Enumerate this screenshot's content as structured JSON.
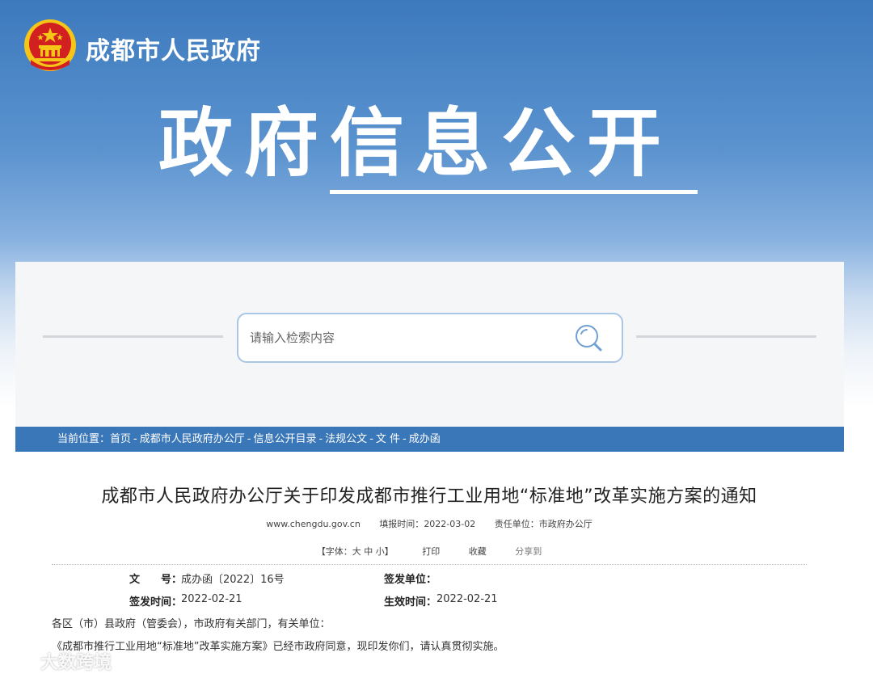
{
  "header": {
    "site_name": "成都市人民政府",
    "section_title": "政府信息公开"
  },
  "search": {
    "placeholder": "请输入检索内容"
  },
  "breadcrumb": {
    "prefix": "当前位置：",
    "items": [
      "首页",
      "成都市人民政府办公厅",
      "信息公开目录",
      "法规公文",
      "文 件",
      "成办函"
    ],
    "separator": "-"
  },
  "document": {
    "title": "成都市人民政府办公厅关于印发成都市推行工业用地“标准地”改革实施方案的通知",
    "meta": {
      "source": "www.chengdu.gov.cn",
      "fill_time_label": "填报时间：",
      "fill_time": "2022-03-02",
      "responsible_label": "责任单位：",
      "responsible": "市政府办公厅"
    },
    "tools": {
      "font_size": "【字体：大 中 小】",
      "print": "打印",
      "favorite": "收藏",
      "share": "分享到"
    },
    "info": {
      "doc_no_label": "文　　号：",
      "doc_no": "成办函〔2022〕16号",
      "issuer_label": "签发单位：",
      "issuer": "",
      "issue_date_label": "签发时间：",
      "issue_date": "2022-02-21",
      "effective_date_label": "生效时间：",
      "effective_date": "2022-02-21"
    },
    "body": [
      "各区（市）县政府（管委会），市政府有关部门，有关单位：",
      "《成都市推行工业用地“标准地”改革实施方案》已经市政府同意，现印发你们，请认真贯彻实施。"
    ]
  },
  "watermark": {
    "text": "大数跨境"
  },
  "colors": {
    "banner_blue": "#3c79bd",
    "breadcrumb_blue": "#3a77b8",
    "search_border": "#a9c6e6",
    "emblem_red": "#d21f1f",
    "emblem_gold": "#f5c518"
  }
}
